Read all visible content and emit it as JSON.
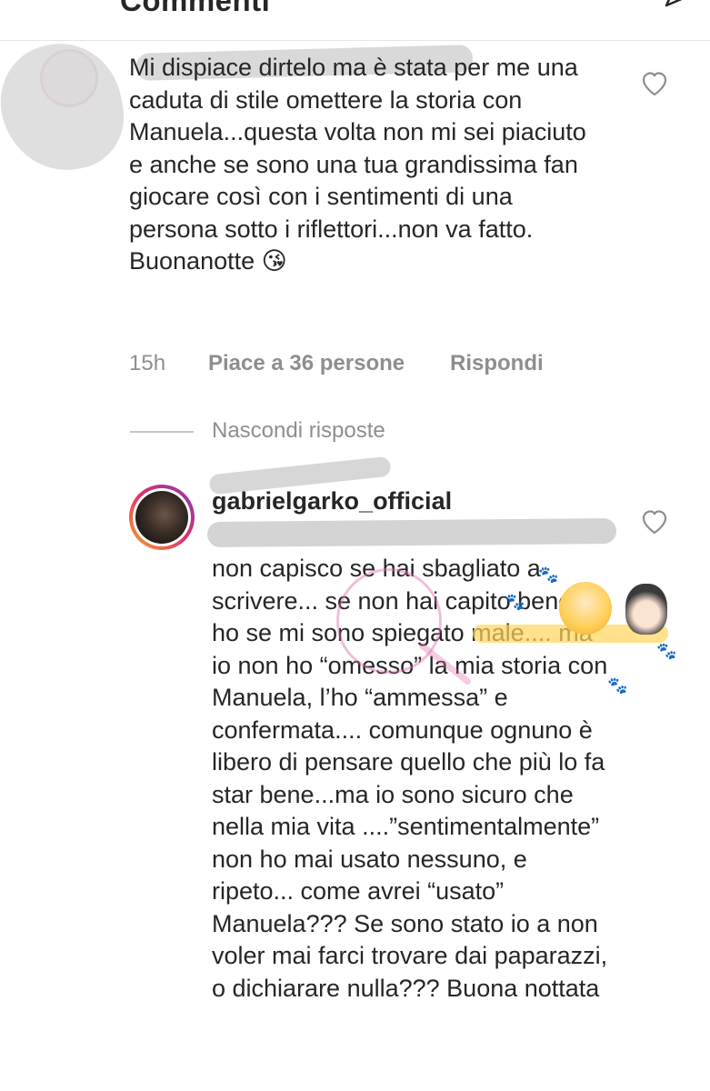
{
  "header": {
    "title": "Commenti"
  },
  "comment": {
    "text": "Mi dispiace dirtelo ma è stata per me una caduta di stile omettere la storia con Manuela...questa volta non mi sei piaciuto e anche se sono una tua grandissima fan giocare così con i sentimenti di una persona sotto i riflettori...non va fatto.\nBuonanotte 😘",
    "time": "15h",
    "likes": "Piace a 36 persone",
    "reply_label": "Rispondi"
  },
  "replies_toggle": "Nascondi risposte",
  "reply": {
    "username": "gabrielgarko_official",
    "text": "non capisco se hai sbagliato a scrivere... se non hai capito bene, ho se mi sono spiegato male.... ma io non ho “omesso” la mia storia con Manuela, l’ho “ammessa” e confermata.... comunque ognuno è libero di pensare quello che più lo fa star bene...ma io sono sicuro che nella mia vita ....”sentimentalmente” non ho mai usato nessuno, e ripeto... come avrei “usato” Manuela??? Se sono stato io a non voler mai farci trovare dai paparazzi, o dichiarare nulla??? Buona nottata"
  },
  "icons": {
    "back": "back-arrow-icon",
    "send": "send-icon",
    "like": "heart-icon"
  },
  "colors": {
    "text": "#262626",
    "muted": "#8e8e8e",
    "story_ring_start": "#f9a825",
    "story_ring_end": "#833ab4"
  }
}
